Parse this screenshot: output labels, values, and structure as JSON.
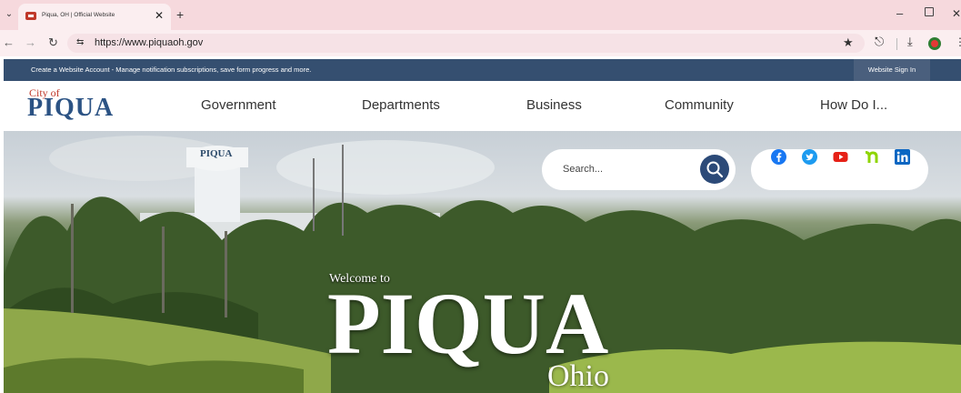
{
  "browser": {
    "tab_title": "Piqua, OH | Official Website",
    "url": "https://www.piquaoh.gov"
  },
  "notice": {
    "text": "Create a Website Account - Manage notification subscriptions, save form progress and more.",
    "signin_label": "Website Sign In"
  },
  "header": {
    "logo_city": "City of",
    "logo_name": "PIQUA",
    "nav": [
      "Government",
      "Departments",
      "Business",
      "Community",
      "How Do I..."
    ]
  },
  "hero": {
    "search_placeholder": "Search...",
    "tower_text": "PIQUA",
    "welcome": "Welcome to",
    "title": "PIQUA",
    "subtitle": "Ohio",
    "social_icons": [
      "facebook-icon",
      "twitter-icon",
      "youtube-icon",
      "nextdoor-icon",
      "linkedin-icon"
    ]
  },
  "colors": {
    "notice_bar": "#354f70",
    "brand_blue": "#2c5384",
    "tab_strip": "#f6d9dd"
  }
}
